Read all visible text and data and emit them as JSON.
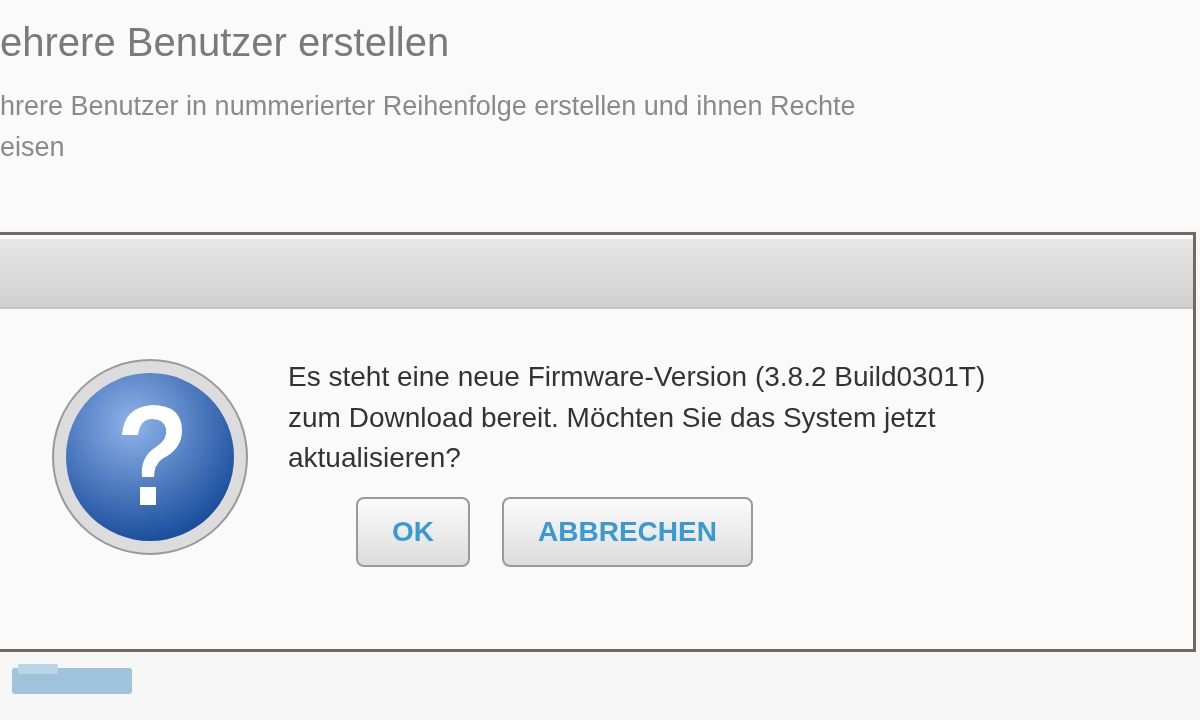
{
  "page": {
    "title": "ehrere Benutzer erstellen",
    "description_lines": [
      "hrere Benutzer in nummerierter Reihenfolge erstellen und ihnen Rechte",
      "eisen"
    ]
  },
  "dialog": {
    "message": "Es steht eine neue Firmware-Version (3.8.2 Build0301T) zum Download bereit. Möchten Sie das System jetzt aktualisieren?",
    "buttons": [
      {
        "label": "OK"
      },
      {
        "label": "ABBRECHEN"
      }
    ]
  }
}
